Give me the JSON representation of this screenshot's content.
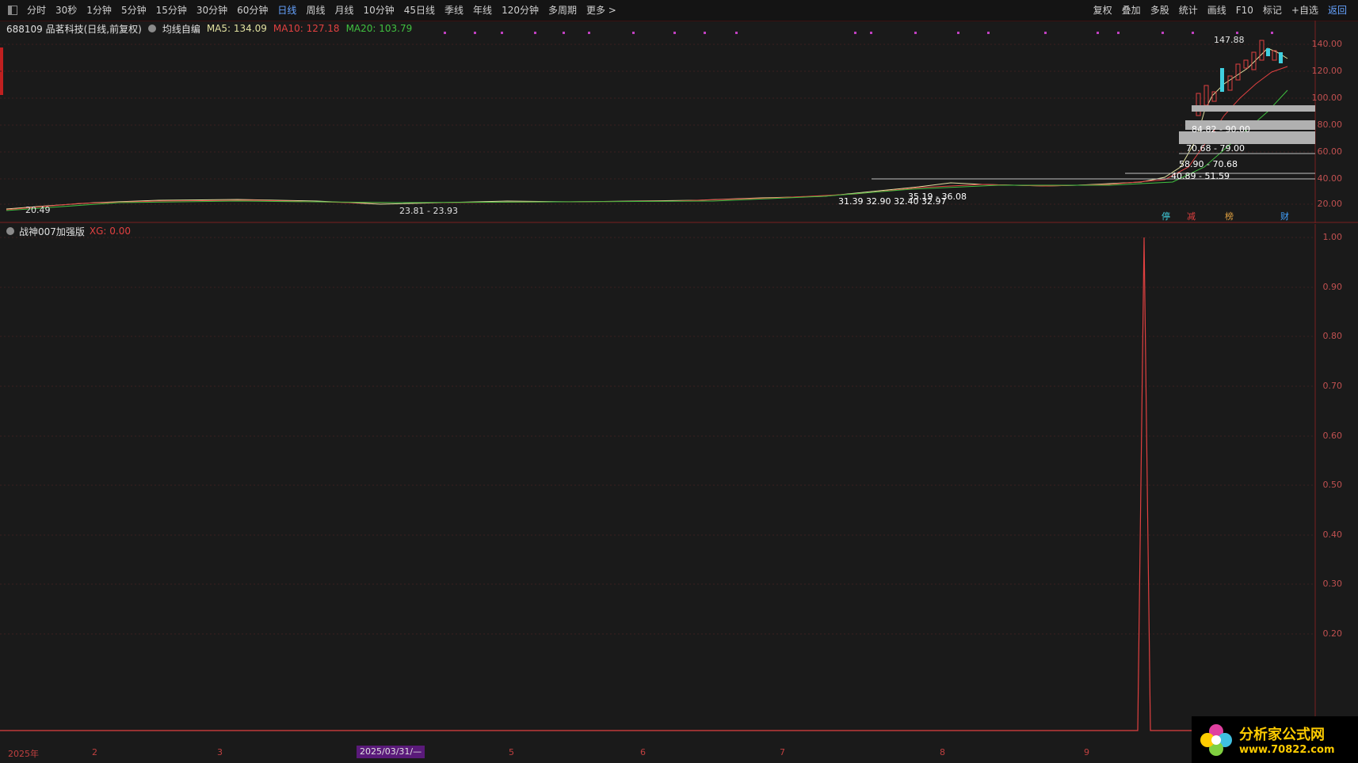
{
  "toolbar": {
    "periods": [
      "分时",
      "30秒",
      "1分钟",
      "5分钟",
      "15分钟",
      "30分钟",
      "60分钟",
      "日线",
      "周线",
      "月线",
      "10分钟",
      "45日线",
      "季线",
      "年线",
      "120分钟",
      "多周期",
      "更多 >"
    ],
    "active_period": "日线",
    "right_items": [
      "复权",
      "叠加",
      "多股",
      "统计",
      "画线",
      "F10",
      "标记",
      "+自选",
      "返回"
    ]
  },
  "stock_info": {
    "title": "688109 品茗科技(日线,前复权)",
    "indicator_name": "均线自编",
    "ma5": "MA5: 134.09",
    "ma10": "MA10: 127.18",
    "ma20": "MA20: 103.79"
  },
  "main_annotations": {
    "high": "147.88",
    "low_left": "20.49",
    "low_mid": "23.81 - 23.93",
    "zone1": "84.82 - 90.00",
    "zone2": "70.68 - 79.00",
    "zone3": "58.90 - 70.68",
    "zone4": "40.89 - 51.59",
    "zone5": "35.19 - 36.08",
    "mid_labels": "31.39 32.90 32.40 32.97",
    "events": [
      "停",
      "减",
      "榜",
      "财"
    ]
  },
  "main_axis": [
    "140.00",
    "120.00",
    "100.00",
    "80.00",
    "60.00",
    "40.00",
    "20.00"
  ],
  "sub_indicator": {
    "name": "战神007加强版",
    "xg_label": "XG: 0.00"
  },
  "sub_axis": [
    "1.00",
    "0.90",
    "0.80",
    "0.70",
    "0.60",
    "0.50",
    "0.40",
    "0.30",
    "0.20"
  ],
  "dates": {
    "year": "2025年",
    "months": [
      "2",
      "3",
      "5",
      "6",
      "7",
      "8",
      "9"
    ],
    "selected": "2025/03/31/—"
  },
  "logo": {
    "cn": "分析家公式网",
    "url": "www.70822.com"
  },
  "chart_data": {
    "type": "line",
    "series": [
      {
        "name": "XG",
        "x_fraction_peak": 0.86,
        "values": [
          0,
          0,
          0,
          0,
          1,
          0,
          0
        ]
      }
    ],
    "ylim": [
      0,
      1
    ]
  },
  "colors": {
    "background": "#1a1a1a",
    "accent_blue": "#66a3ff",
    "up_red": "#e04040",
    "down_cyan": "#40d0e0",
    "ma5": "#e0e0a0",
    "ma10": "#e04040",
    "ma20": "#40c040"
  }
}
